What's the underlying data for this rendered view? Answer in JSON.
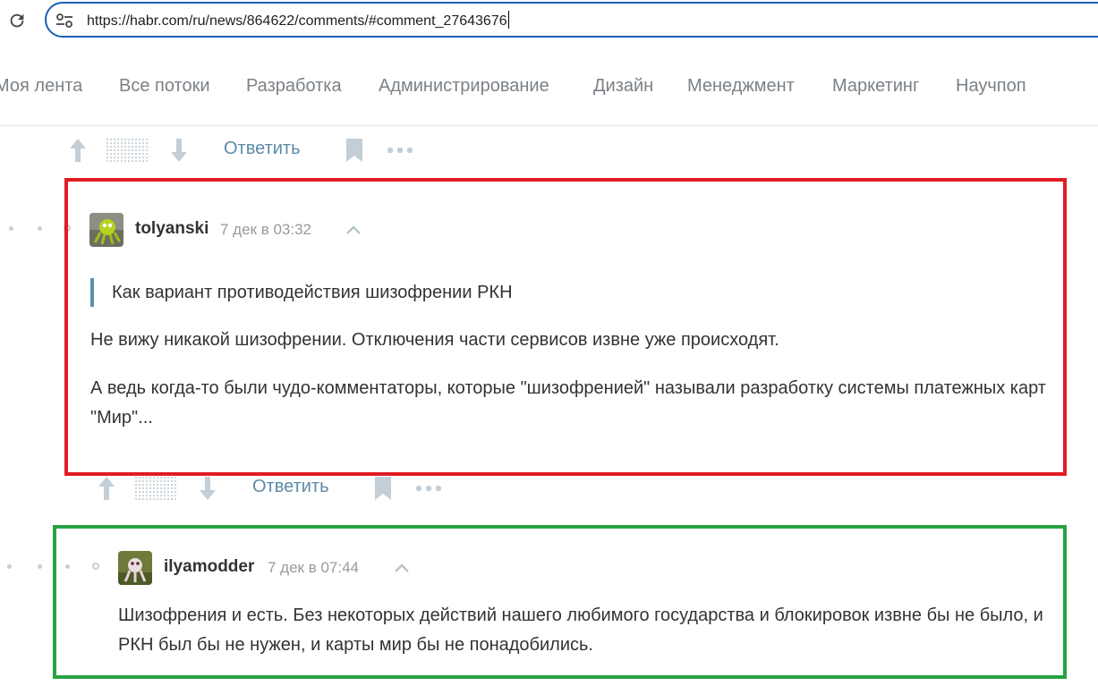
{
  "browser": {
    "url": "https://habr.com/ru/news/864622/comments/#comment_27643676"
  },
  "nav": {
    "items": [
      "Моя лента",
      "Все потоки",
      "Разработка",
      "Администрирование",
      "Дизайн",
      "Менеджмент",
      "Маркетинг",
      "Научпоп"
    ]
  },
  "actions": {
    "reply_label": "Ответить"
  },
  "comments": [
    {
      "username": "tolyanski",
      "timestamp": "7 дек в 03:32",
      "quote": "Как вариант противодействия шизофрении РКН",
      "paragraphs": [
        "Не вижу никакой шизофрении. Отключения части сервисов извне уже происходят.",
        "А ведь когда-то были чудо-комментаторы, которые \"шизофренией\" называли разработку системы платежных карт \"Мир\"..."
      ],
      "highlight_color": "#e01b24"
    },
    {
      "username": "ilyamodder",
      "timestamp": "7 дек в 07:44",
      "paragraphs": [
        "Шизофрения и есть. Без некоторых действий нашего любимого государства и блокировок извне бы не было, и РКН был бы не нужен, и карты мир бы не понадобились."
      ],
      "highlight_color": "#26a244"
    }
  ]
}
